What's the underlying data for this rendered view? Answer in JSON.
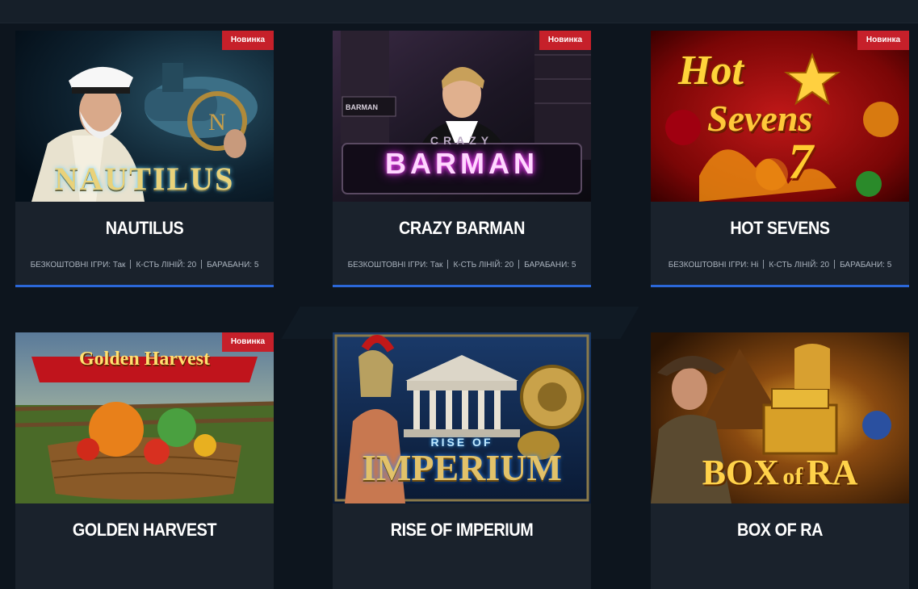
{
  "badge_label": "Новинка",
  "games": [
    {
      "title": "NAUTILUS",
      "logo_text": "NAUTILUS",
      "badge": true,
      "meta": {
        "free_label": "БЕЗКОШТОВНІ ІГРИ:",
        "free": "Так",
        "lines_label": "К-СТЬ ЛІНІЙ:",
        "lines": "20",
        "reels_label": "БАРАБАНИ:",
        "reels": "5"
      }
    },
    {
      "title": "CRAZY BARMAN",
      "logo_text": "BARMAN",
      "logo_sub": "CRAZY",
      "sign_text": "BARMAN",
      "badge": true,
      "meta": {
        "free_label": "БЕЗКОШТОВНІ ІГРИ:",
        "free": "Так",
        "lines_label": "К-СТЬ ЛІНІЙ:",
        "lines": "20",
        "reels_label": "БАРАБАНИ:",
        "reels": "5"
      }
    },
    {
      "title": "HOT SEVENS",
      "logo_text": "Hot",
      "logo_sub": "Sevens",
      "logo_num": "7",
      "badge": true,
      "meta": {
        "free_label": "БЕЗКОШТОВНІ ІГРИ:",
        "free": "Ні",
        "lines_label": "К-СТЬ ЛІНІЙ:",
        "lines": "20",
        "reels_label": "БАРАБАНИ:",
        "reels": "5"
      }
    },
    {
      "title": "GOLDEN HARVEST",
      "logo_text": "Golden Harvest",
      "badge": true
    },
    {
      "title": "RISE OF IMPERIUM",
      "logo_text": "IMPERIUM",
      "logo_sub": "RISE OF",
      "badge": false
    },
    {
      "title": "BOX OF RA",
      "logo_text": "BOX",
      "logo_sub": "of",
      "logo_num": "RA",
      "badge": false
    }
  ],
  "colors": {
    "page_bg": "#0d151e",
    "card_bg": "#1a222c",
    "badge_bg": "#c6202a",
    "accent_line": "#2b67d8"
  }
}
